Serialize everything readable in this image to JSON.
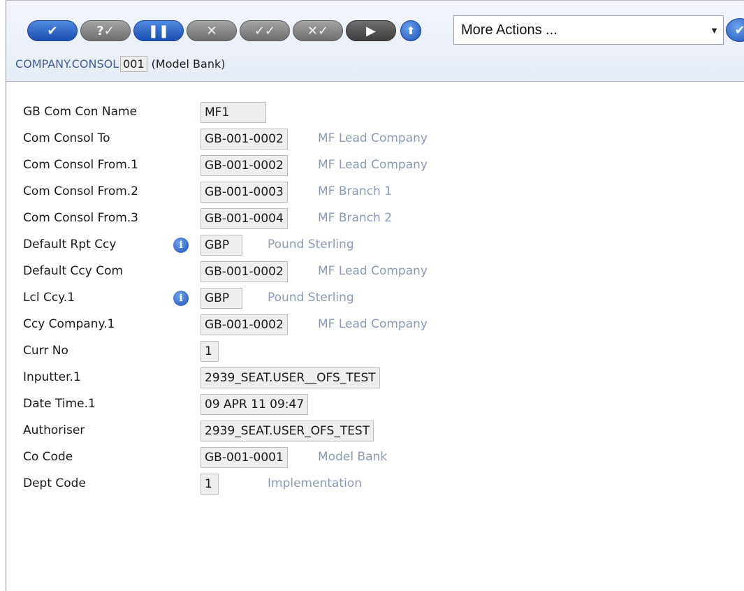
{
  "toolbar": {
    "buttons": [
      {
        "icon": "check-icon",
        "glyph": "✔"
      },
      {
        "icon": "validate-icon",
        "glyph": "?✓"
      },
      {
        "icon": "hold-icon",
        "glyph": "❚❚"
      },
      {
        "icon": "delete-icon",
        "glyph": "✕"
      },
      {
        "icon": "authorise-icon",
        "glyph": "✓✓"
      },
      {
        "icon": "reverse-icon",
        "glyph": "✕✓"
      },
      {
        "icon": "next-icon",
        "glyph": "▶"
      }
    ],
    "upload_glyph": "⬆",
    "actions_select": {
      "value": "More Actions ...",
      "arrow": "▼"
    },
    "go_glyph": "✔"
  },
  "record": {
    "application": "COMPANY.CONSOL",
    "id": "001",
    "description": "(Model Bank)"
  },
  "fields": [
    {
      "label": "GB Com Con Name",
      "value": "MF1",
      "description": ""
    },
    {
      "label": "Com Consol To",
      "value": "GB-001-0002",
      "description": "MF Lead Company"
    },
    {
      "label": "Com Consol From.1",
      "value": "GB-001-0002",
      "description": "MF Lead Company"
    },
    {
      "label": "Com Consol From.2",
      "value": "GB-001-0003",
      "description": "MF Branch 1"
    },
    {
      "label": "Com Consol From.3",
      "value": "GB-001-0004",
      "description": "MF Branch 2"
    },
    {
      "label": "Default Rpt Ccy",
      "value": "GBP",
      "description": "Pound Sterling",
      "info": "i"
    },
    {
      "label": "Default Ccy Com",
      "value": "GB-001-0002",
      "description": "MF Lead Company"
    },
    {
      "label": "Lcl Ccy.1",
      "value": "GBP",
      "description": "Pound Sterling",
      "info": "i"
    },
    {
      "label": "Ccy Company.1",
      "value": "GB-001-0002",
      "description": "MF Lead Company"
    },
    {
      "label": "Curr No",
      "value": "1",
      "description": ""
    },
    {
      "label": "Inputter.1",
      "value": "2939_SEAT.USER__OFS_TEST",
      "description": ""
    },
    {
      "label": "Date Time.1",
      "value": "09 APR 11 09:47",
      "description": ""
    },
    {
      "label": "Authoriser",
      "value": "2939_SEAT.USER_OFS_TEST",
      "description": ""
    },
    {
      "label": "Co Code",
      "value": "GB-001-0001",
      "description": "Model Bank"
    },
    {
      "label": "Dept Code",
      "value": "1",
      "description": "Implementation"
    }
  ]
}
